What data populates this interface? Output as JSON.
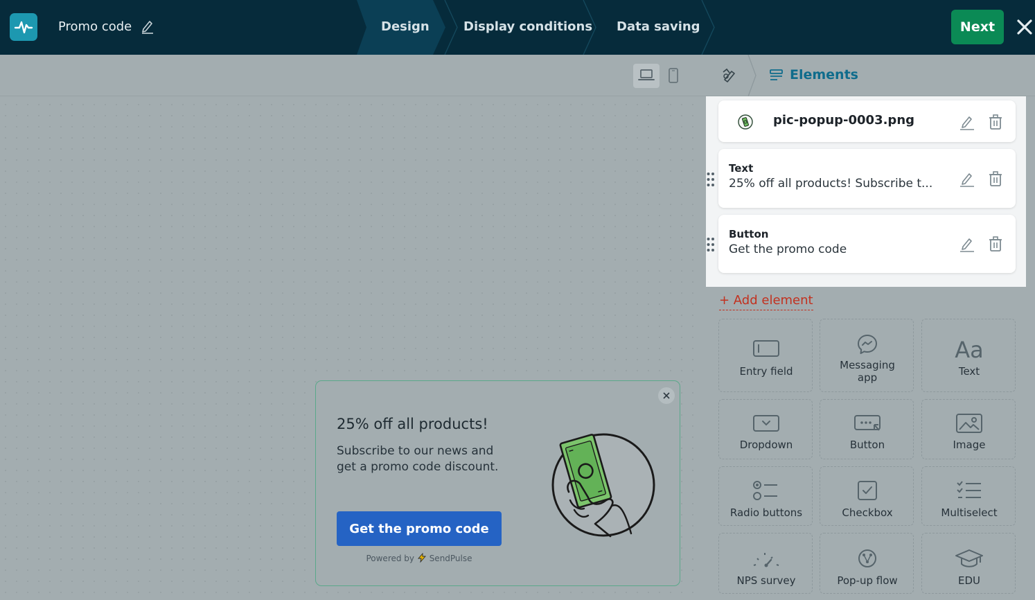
{
  "header": {
    "form_title": "Promo code",
    "steps": [
      "Design",
      "Display conditions",
      "Data saving"
    ],
    "active_step": "Design",
    "next_label": "Next"
  },
  "popup": {
    "headline": "25% off all products!",
    "body": "Subscribe to our news and get a promo code discount.",
    "button_label": "Get the promo code",
    "powered_prefix": "Powered by",
    "powered_brand": "SendPulse"
  },
  "panel": {
    "tab_label": "Elements",
    "elements": [
      {
        "title": "pic-popup-0003.png",
        "subtitle": ""
      },
      {
        "title": "Text",
        "subtitle": "25% off all products! Subscribe t..."
      },
      {
        "title": "Button",
        "subtitle": "Get the promo code"
      }
    ],
    "add_element_label": "+ Add element",
    "palette": [
      {
        "label": "Entry field",
        "icon": "entry-field-icon"
      },
      {
        "label": "Messaging app",
        "icon": "messenger-icon"
      },
      {
        "label": "Text",
        "icon": "text-icon"
      },
      {
        "label": "Dropdown",
        "icon": "dropdown-icon"
      },
      {
        "label": "Button",
        "icon": "button-icon"
      },
      {
        "label": "Image",
        "icon": "image-icon"
      },
      {
        "label": "Radio buttons",
        "icon": "radio-buttons-icon"
      },
      {
        "label": "Checkbox",
        "icon": "checkbox-icon"
      },
      {
        "label": "Multiselect",
        "icon": "multiselect-icon"
      },
      {
        "label": "NPS survey",
        "icon": "nps-survey-icon"
      },
      {
        "label": "Pop-up flow",
        "icon": "popup-flow-icon"
      },
      {
        "label": "EDU",
        "icon": "edu-icon"
      }
    ]
  },
  "colors": {
    "topbar": "#062b3b",
    "accent_green": "#0b8a55",
    "popup_button": "#2563c4",
    "add_element": "#c2311f",
    "elements_tab": "#0f6c8c"
  }
}
